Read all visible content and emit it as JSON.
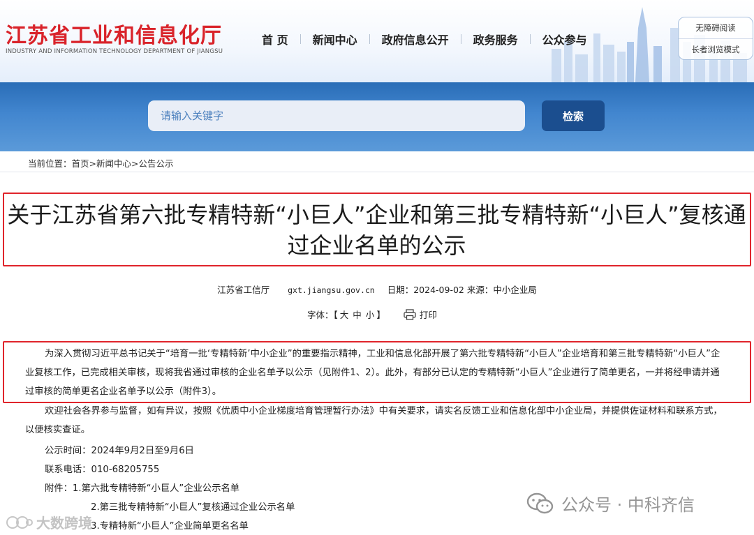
{
  "site": {
    "name_cn": "江苏省工业和信息化厅",
    "name_en": "INDUSTRY AND INFORMATION TECHNOLOGY DEPARTMENT OF JIANGSU"
  },
  "nav": [
    "首 页",
    "新闻中心",
    "政府信息公开",
    "政务服务",
    "公众参与"
  ],
  "accessibility": {
    "barrier_free": "无障碍阅读",
    "elderly_mode": "长者浏览模式"
  },
  "search": {
    "placeholder": "请输入关键字",
    "button": "检索"
  },
  "breadcrumb": {
    "prefix": "当前位置：",
    "items": [
      "首页",
      "新闻中心",
      "公告公示"
    ],
    "separator": ">"
  },
  "article": {
    "title": "关于江苏省第六批专精特新“小巨人”企业和第三批专精特新“小巨人”复核通过企业名单的公示",
    "publisher": "江苏省工信厅",
    "url": "gxt.jiangsu.gov.cn",
    "date_label": "日期：",
    "date": "2024-09-02",
    "source_label": "来源：",
    "source": "中小企业局",
    "font_label": "字体：【",
    "font_close": "】",
    "font_sizes": [
      "大",
      "中",
      "小"
    ],
    "print_label": "打印",
    "paragraph1": "为深入贯彻习近平总书记关于“培育一批‘专精特新’中小企业”的重要指示精神，工业和信息化部开展了第六批专精特新“小巨人”企业培育和第三批专精特新“小巨人”企业复核工作，已完成相关审核，现将我省通过审核的企业名单予以公示（见附件1、2）。此外，有部分已认定的专精特新“小巨人”企业进行了简单更名，一并将经申请并通过审核的简单更名企业名单予以公示（附件3）。",
    "paragraph2": "欢迎社会各界参与监督，如有异议，按照《优质中小企业梯度培育管理暂行办法》中有关要求，请实名反馈工业和信息化部中小企业局，并提供佐证材料和联系方式，以便核实查证。",
    "publicity_time": "公示时间：2024年9月2日至9月6日",
    "phone": "联系电话：010-68205755",
    "attachments_label": "附件：",
    "attachments": [
      "1.第六批专精特新“小巨人”企业公示名单",
      "2.第三批专精特新“小巨人”复核通过企业公示名单",
      "3.专精特新“小巨人”企业简单更名名单"
    ]
  },
  "watermarks": {
    "right": "公众号 · 中科齐信",
    "left": "大数跨境"
  },
  "colors": {
    "brand_red": "#d9232a",
    "highlight_red": "#e0242b",
    "band_blue": "#3a7cc6",
    "button_blue": "#1b4e8f"
  }
}
